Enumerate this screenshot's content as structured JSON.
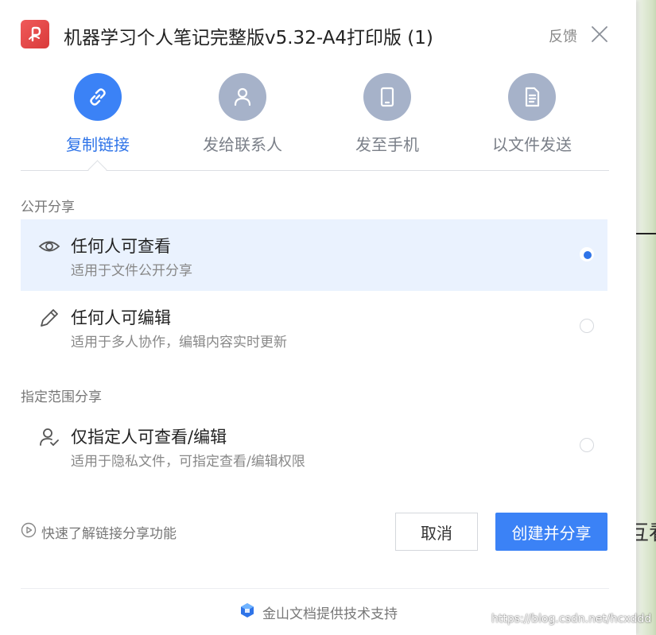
{
  "dialog": {
    "title": "机器学习个人笔记完整版v5.32-A4打印版 (1)",
    "feedback_label": "反馈",
    "app_icon": "pdf-icon",
    "close_icon": "close-icon"
  },
  "methods": [
    {
      "label": "复制链接",
      "icon": "link-icon",
      "active": true
    },
    {
      "label": "发给联系人",
      "icon": "contact-icon",
      "active": false
    },
    {
      "label": "发至手机",
      "icon": "phone-icon",
      "active": false
    },
    {
      "label": "以文件发送",
      "icon": "file-icon",
      "active": false
    }
  ],
  "public_share": {
    "section_title": "公开分享",
    "options": [
      {
        "title": "任何人可查看",
        "desc": "适用于文件公开分享",
        "icon": "eye-icon",
        "selected": true
      },
      {
        "title": "任何人可编辑",
        "desc": "适用于多人协作，编辑内容实时更新",
        "icon": "pencil-icon",
        "selected": false
      }
    ]
  },
  "restricted_share": {
    "section_title": "指定范围分享",
    "options": [
      {
        "title": "仅指定人可查看/编辑",
        "desc": "适用于隐私文件，可指定查看/编辑权限",
        "icon": "user-check-icon",
        "selected": false
      }
    ]
  },
  "footer": {
    "help_link": "快速了解链接分享功能",
    "cancel_label": "取消",
    "create_label": "创建并分享",
    "powered_by": "金山文档提供技术支持"
  },
  "background": {
    "glyph_text": "互看",
    "watermark": "https://blog.csdn.net/hcxddd"
  },
  "colors": {
    "accent": "#3b82f6",
    "icon_inactive": "#a6b2c9",
    "selected_bg": "#eaf2fe",
    "app_icon": "#e84a4a"
  }
}
